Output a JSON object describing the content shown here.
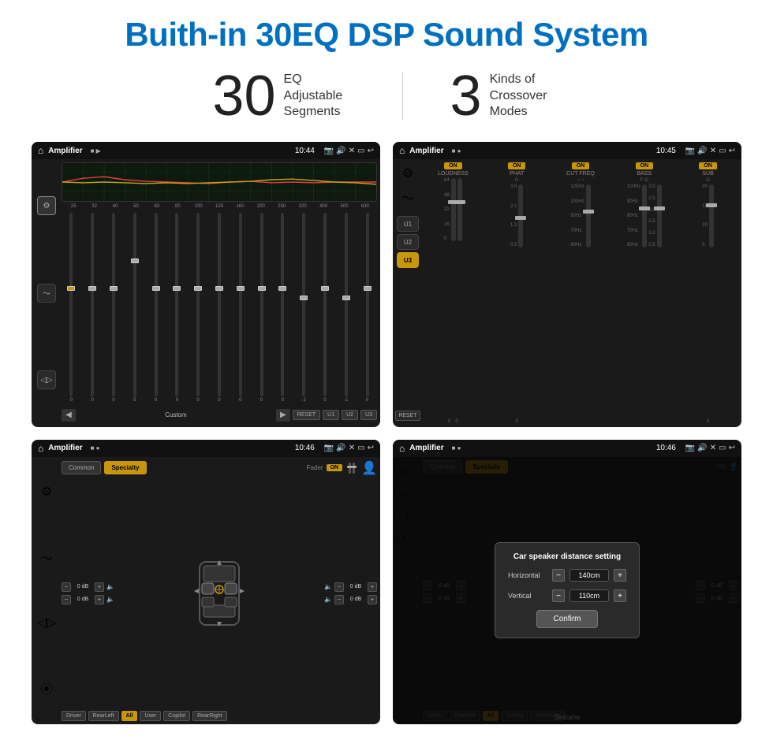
{
  "title": "Buith-in 30EQ DSP Sound System",
  "stats": [
    {
      "number": "30",
      "label": "EQ Adjustable\nSegments"
    },
    {
      "number": "3",
      "label": "Kinds of\nCrossover Modes"
    }
  ],
  "screens": {
    "top_left": {
      "app_name": "Amplifier",
      "time": "10:44",
      "eq_freqs": [
        "25",
        "32",
        "40",
        "50",
        "63",
        "80",
        "100",
        "125",
        "160",
        "200",
        "250",
        "320",
        "400",
        "500",
        "630"
      ],
      "eq_values": [
        "0",
        "0",
        "0",
        "5",
        "0",
        "0",
        "0",
        "0",
        "0",
        "0",
        "0",
        "-1",
        "0",
        "-1"
      ],
      "custom_label": "Custom",
      "buttons": [
        "RESET",
        "U1",
        "U2",
        "U3"
      ]
    },
    "top_right": {
      "app_name": "Amplifier",
      "time": "10:45",
      "channels": [
        "LOUDNESS",
        "PHAT",
        "CUT FREQ",
        "BASS",
        "SUB"
      ],
      "on_labels": [
        "ON",
        "ON",
        "ON",
        "ON",
        "ON"
      ],
      "user_buttons": [
        "U1",
        "U2",
        "U3"
      ],
      "reset_label": "RESET"
    },
    "bottom_left": {
      "app_name": "Amplifier",
      "time": "10:46",
      "tab_common": "Common",
      "tab_specialty": "Specialty",
      "fader_label": "Fader",
      "fader_on": "ON",
      "vol_labels": [
        "0 dB",
        "0 dB",
        "0 dB",
        "0 dB"
      ],
      "position_buttons": [
        "Driver",
        "RearLeft",
        "All",
        "User",
        "Copilot",
        "RearRight"
      ]
    },
    "bottom_right": {
      "app_name": "Amplifier",
      "time": "10:46",
      "tab_common": "Common",
      "tab_specialty": "Specialty",
      "dialog_title": "Car speaker distance setting",
      "horizontal_label": "Horizontal",
      "horizontal_value": "140cm",
      "vertical_label": "Vertical",
      "vertical_value": "110cm",
      "confirm_label": "Confirm",
      "vol_right1": "0 dB",
      "vol_right2": "0 dB",
      "position_buttons": [
        "Driver",
        "RearLeft",
        "All",
        "Copilot",
        "RearRight"
      ]
    }
  },
  "watermark": "Seicane"
}
